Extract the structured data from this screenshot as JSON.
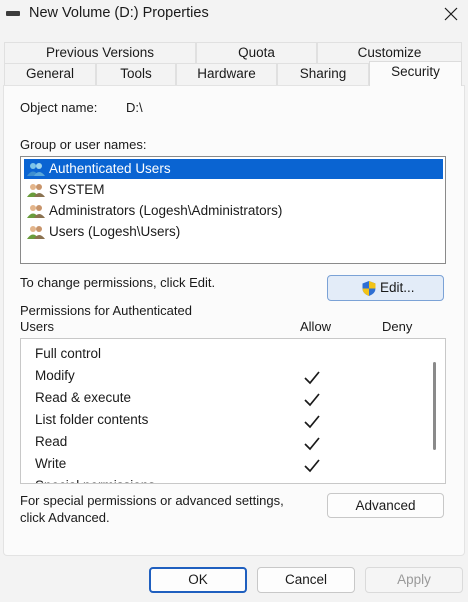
{
  "window": {
    "title": "New Volume (D:) Properties",
    "close_label": "×"
  },
  "tabs_row1": [
    {
      "label": "Previous Versions"
    },
    {
      "label": "Quota"
    },
    {
      "label": "Customize"
    }
  ],
  "tabs_row2": [
    {
      "label": "General"
    },
    {
      "label": "Tools"
    },
    {
      "label": "Hardware"
    },
    {
      "label": "Sharing"
    },
    {
      "label": "Security",
      "active": true
    }
  ],
  "security": {
    "object_name_label": "Object name:",
    "object_name_value": "D:\\",
    "group_label": "Group or user names:",
    "users": [
      {
        "name": "Authenticated Users",
        "selected": true
      },
      {
        "name": "SYSTEM"
      },
      {
        "name": "Administrators (Logesh\\Administrators)"
      },
      {
        "name": "Users (Logesh\\Users)"
      }
    ],
    "change_hint": "To change permissions, click Edit.",
    "edit_label": "Edit...",
    "permissions_for_line1": "Permissions for Authenticated",
    "permissions_for_line2": "Users",
    "allow_header": "Allow",
    "deny_header": "Deny",
    "permissions": [
      {
        "name": "Full control",
        "allow": false,
        "deny": false
      },
      {
        "name": "Modify",
        "allow": true,
        "deny": false
      },
      {
        "name": "Read & execute",
        "allow": true,
        "deny": false
      },
      {
        "name": "List folder contents",
        "allow": true,
        "deny": false
      },
      {
        "name": "Read",
        "allow": true,
        "deny": false
      },
      {
        "name": "Write",
        "allow": true,
        "deny": false
      },
      {
        "name": "Special permissions",
        "allow": false,
        "deny": false
      }
    ],
    "advanced_hint_line1": "For special permissions or advanced settings,",
    "advanced_hint_line2": "click Advanced.",
    "advanced_label": "Advanced"
  },
  "footer": {
    "ok_label": "OK",
    "cancel_label": "Cancel",
    "apply_label": "Apply"
  },
  "colors": {
    "selection": "#0a64d2",
    "accent_border": "#1f5fbf",
    "background": "#f3f3f3"
  }
}
